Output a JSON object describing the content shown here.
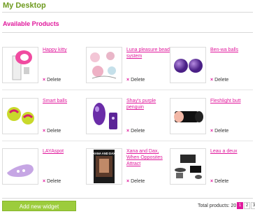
{
  "page": {
    "title": "My Desktop",
    "section_title": "Available Products"
  },
  "products": [
    {
      "name": "Happy kitty",
      "delete": "Delete",
      "image": "pink-suction-toy-image"
    },
    {
      "name": "Luna pleasure bead system",
      "delete": "Delete",
      "image": "pink-beads-image"
    },
    {
      "name": "Ben-wa balls",
      "delete": "Delete",
      "image": "purple-balls-image"
    },
    {
      "name": "Smart balls",
      "delete": "Delete",
      "image": "green-balls-image"
    },
    {
      "name": "Shay's purple penguin",
      "delete": "Delete",
      "image": "purple-toy-image"
    },
    {
      "name": "Fleshlight butt",
      "delete": "Delete",
      "image": "black-fleshlight-image"
    },
    {
      "name": "LAYAspot",
      "delete": "Delete",
      "image": "lilac-toy-image"
    },
    {
      "name": "Xana and Dax, When Opposites Attract",
      "delete": "Delete",
      "image": "dvd-cover-image",
      "cover_text": "XANA AND DAX"
    },
    {
      "name": "Leau a deux",
      "delete": "Delete",
      "image": "black-kit-image"
    }
  ],
  "footer": {
    "add_widget": "Add new widget",
    "total_label": "Total products: 20",
    "pages": [
      "1",
      "2",
      "3"
    ],
    "current_page": "1"
  },
  "colors": {
    "accent_pink": "#e0189c",
    "brand_green": "#6e9a1e",
    "button_green": "#9ccc3c"
  }
}
